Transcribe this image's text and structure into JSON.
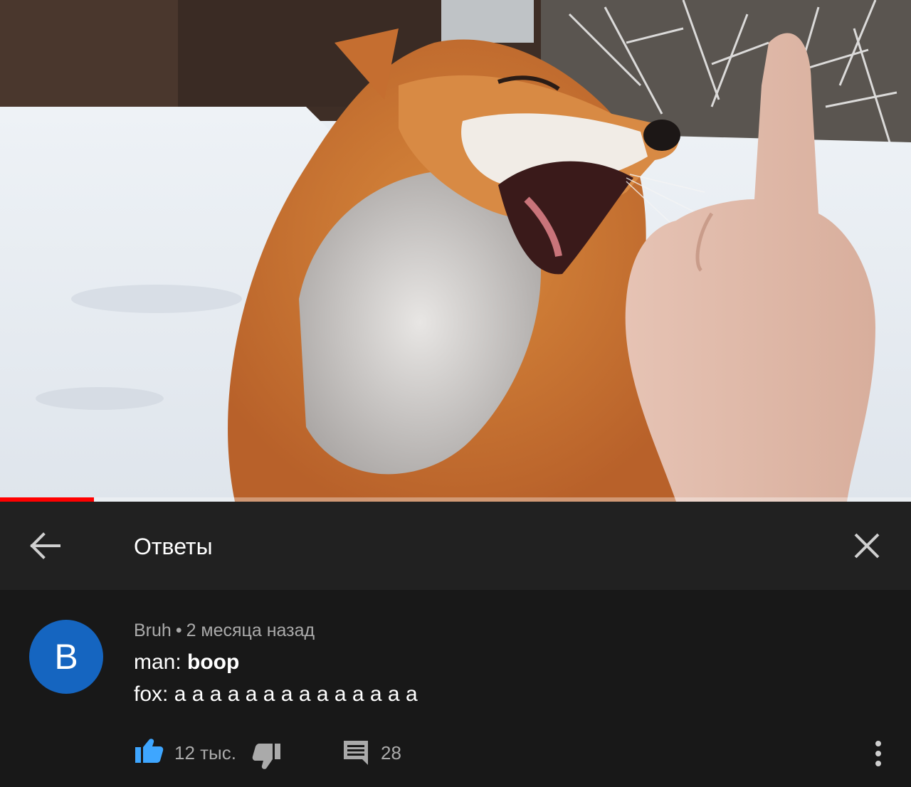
{
  "video": {
    "progress_fraction": 0.103,
    "progress_color": "#ff0000"
  },
  "header": {
    "back_icon": "arrow-back-icon",
    "title": "Ответы",
    "close_icon": "close-icon"
  },
  "comment": {
    "avatar_letter": "B",
    "avatar_color": "#1565c0",
    "author": "Bruh",
    "separator": "•",
    "time": "2 месяца назад",
    "line1_prefix": "man: ",
    "line1_bold": "boop",
    "line2": "fox: а а а а а а а а а а а а а а",
    "like_icon": "thumb-up-icon",
    "like_count": "12 тыс.",
    "dislike_icon": "thumb-down-icon",
    "reply_icon": "reply-comment-icon",
    "reply_count": "28",
    "more_icon": "more-vert-icon",
    "accent_like_color": "#3ea6ff"
  }
}
